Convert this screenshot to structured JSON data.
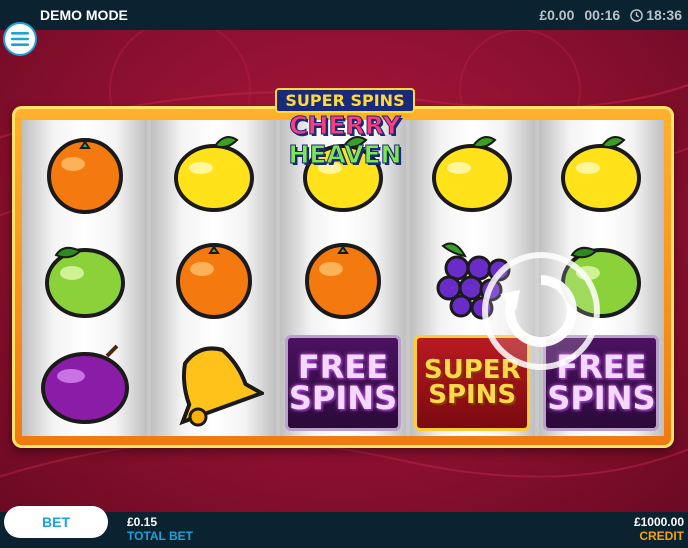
{
  "top_bar": {
    "mode": "DEMO MODE",
    "balance": "£0.00",
    "session_time": "00:16",
    "clock_time": "18:36"
  },
  "logo": {
    "line1": "SUPER SPINS",
    "line2a": "CHERRY ",
    "line2b": "HEAVEN"
  },
  "reels": [
    [
      "orange",
      "lime",
      "plum"
    ],
    [
      "lemon",
      "orange",
      "bell"
    ],
    [
      "lemon",
      "orange",
      "free-spins"
    ],
    [
      "lemon",
      "grapes",
      "super-spins"
    ],
    [
      "lemon",
      "lime",
      "free-spins"
    ]
  ],
  "symbol_labels": {
    "free_spins_1": "FREE",
    "free_spins_2": "SPINS",
    "super_spins_1": "SUPER",
    "super_spins_2": "SPINS"
  },
  "bottom_bar": {
    "bet_button": "BET",
    "total_bet_value": "£0.15",
    "total_bet_label": "TOTAL BET",
    "credit_value": "£1000.00",
    "credit_label": "CREDIT"
  },
  "colors": {
    "bar_bg": "#0b2230",
    "accent_blue": "#1aa3d8",
    "credit_orange": "#f5a400",
    "background_red": "#8a0f2c"
  }
}
